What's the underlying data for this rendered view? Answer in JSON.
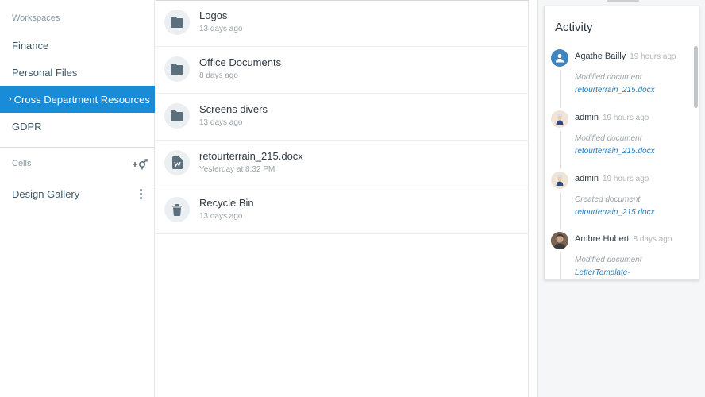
{
  "sidebar": {
    "workspaces_label": "Workspaces",
    "items": [
      {
        "label": "Finance"
      },
      {
        "label": "Personal Files"
      },
      {
        "label": "Cross Department Resources",
        "active": true
      },
      {
        "label": "GDPR"
      }
    ],
    "cells_label": "Cells",
    "cells": [
      {
        "label": "Design Gallery"
      }
    ],
    "active_color": "#1a8bd6"
  },
  "files": [
    {
      "name": "Logos",
      "date": "13 days ago",
      "icon": "folder-icon"
    },
    {
      "name": "Office Documents",
      "date": "8 days ago",
      "icon": "folder-icon"
    },
    {
      "name": "Screens divers",
      "date": "13 days ago",
      "icon": "folder-icon"
    },
    {
      "name": "retourterrain_215.docx",
      "date": "Yesterday at 8:32 PM",
      "icon": "word-document-icon"
    },
    {
      "name": "Recycle Bin",
      "date": "13 days ago",
      "icon": "trash-icon"
    }
  ],
  "activity": {
    "title": "Activity",
    "items": [
      {
        "user": "Agathe Bailly",
        "time": "19 hours ago",
        "action": "Modified document",
        "target": "retourterrain_215.docx",
        "avatar": "user-silhouette-icon"
      },
      {
        "user": "admin",
        "time": "19 hours ago",
        "action": "Modified document",
        "target": "retourterrain_215.docx",
        "avatar": "admin-avatar"
      },
      {
        "user": "admin",
        "time": "19 hours ago",
        "action": "Created document",
        "target": "retourterrain_215.docx",
        "avatar": "admin-avatar"
      },
      {
        "user": "Ambre Hubert",
        "time": "8 days ago",
        "action": "Modified document",
        "target": "LetterTemplate-",
        "avatar": "photo-avatar"
      }
    ]
  }
}
